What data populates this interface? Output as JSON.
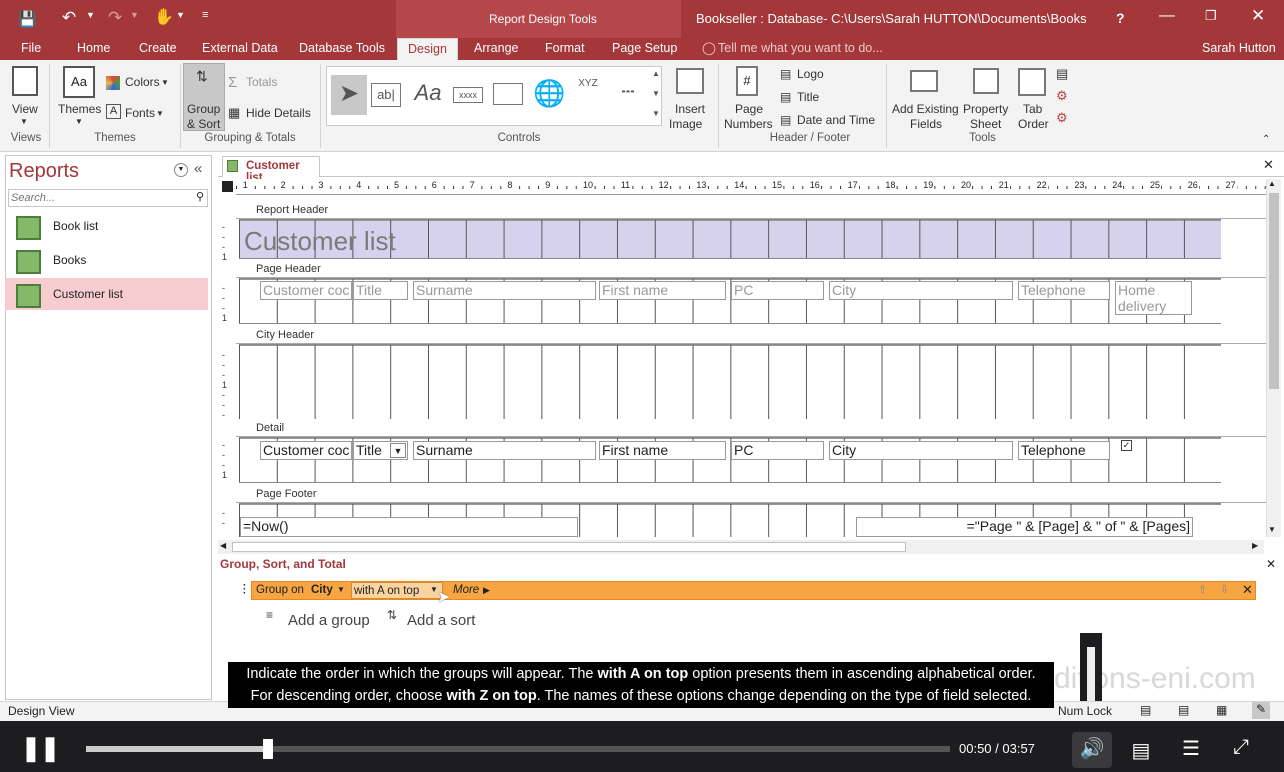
{
  "window": {
    "context_tab": "Report Design Tools",
    "title": "Bookseller : Database- C:\\Users\\Sarah HUTTON\\Documents\\Bookseller....",
    "help": "?",
    "user": "Sarah Hutton"
  },
  "ribbon_tabs": [
    "File",
    "Home",
    "Create",
    "External Data",
    "Database Tools",
    "Design",
    "Arrange",
    "Format",
    "Page Setup"
  ],
  "active_tab": "Design",
  "tell_me": "Tell me what you want to do...",
  "ribbon": {
    "view": "View",
    "themes": "Themes",
    "colors": "Colors",
    "fonts": "Fonts",
    "group_sort_1": "Group",
    "group_sort_2": "& Sort",
    "totals": "Totals",
    "hide_details": "Hide Details",
    "insert_image_1": "Insert",
    "insert_image_2": "Image",
    "page_numbers_1": "Page",
    "page_numbers_2": "Numbers",
    "logo": "Logo",
    "title": "Title",
    "date_time": "Date and Time",
    "add_fields_1": "Add Existing",
    "add_fields_2": "Fields",
    "prop_sheet_1": "Property",
    "prop_sheet_2": "Sheet",
    "tab_order_1": "Tab",
    "tab_order_2": "Order",
    "groups": {
      "views": "Views",
      "themes": "Themes",
      "grouping": "Grouping & Totals",
      "controls": "Controls",
      "header_footer": "Header / Footer",
      "tools": "Tools"
    }
  },
  "nav": {
    "title": "Reports",
    "search_placeholder": "Search...",
    "items": [
      "Book list",
      "Books",
      "Customer list"
    ],
    "selected": "Customer list"
  },
  "document": {
    "tab": "Customer list",
    "sections": {
      "report_header": "Report Header",
      "page_header": "Page Header",
      "city_header": "City Header",
      "detail": "Detail",
      "page_footer": "Page Footer"
    },
    "report_title": "Customer list",
    "header_labels": [
      "Customer coc",
      "Title",
      "Surname",
      "First name",
      "PC",
      "City",
      "Telephone",
      "Home delivery"
    ],
    "detail_fields": [
      "Customer coc",
      "Title",
      "Surname",
      "First name",
      "PC",
      "City",
      "Telephone"
    ],
    "footer_now": "=Now()",
    "footer_pages": "=\"Page \" & [Page] & \" of \" & [Pages]",
    "ruler_numbers": [
      "1",
      "2",
      "3",
      "4",
      "5",
      "6",
      "7",
      "8",
      "9",
      "10",
      "11",
      "12",
      "13",
      "14",
      "15",
      "16",
      "17",
      "18",
      "19",
      "20",
      "21",
      "22",
      "23",
      "24",
      "25",
      "26",
      "27"
    ]
  },
  "group_panel": {
    "title": "Group, Sort, and Total",
    "group_on": "Group on",
    "field": "City",
    "order": "with A on top",
    "more": "More",
    "add_group": "Add a group",
    "add_sort": "Add a sort"
  },
  "status": {
    "left": "Design View",
    "right": "Num Lock"
  },
  "caption": {
    "line1_a": "Indicate the order in which the groups will appear. The ",
    "line1_b": "with A on top",
    "line1_c": " option presents them in ascending alphabetical order.",
    "line2_a": "For descending order, choose ",
    "line2_b": "with Z on top",
    "line2_c": ". The names of these options change depending on the type of field selected."
  },
  "watermark": "ditions-eni.com",
  "player": {
    "time": "00:50 / 03:57",
    "progress": 0.21
  },
  "colors": {
    "accent": "#a4373a",
    "group_row": "#f7a442",
    "selected": "#f8cdd2"
  }
}
